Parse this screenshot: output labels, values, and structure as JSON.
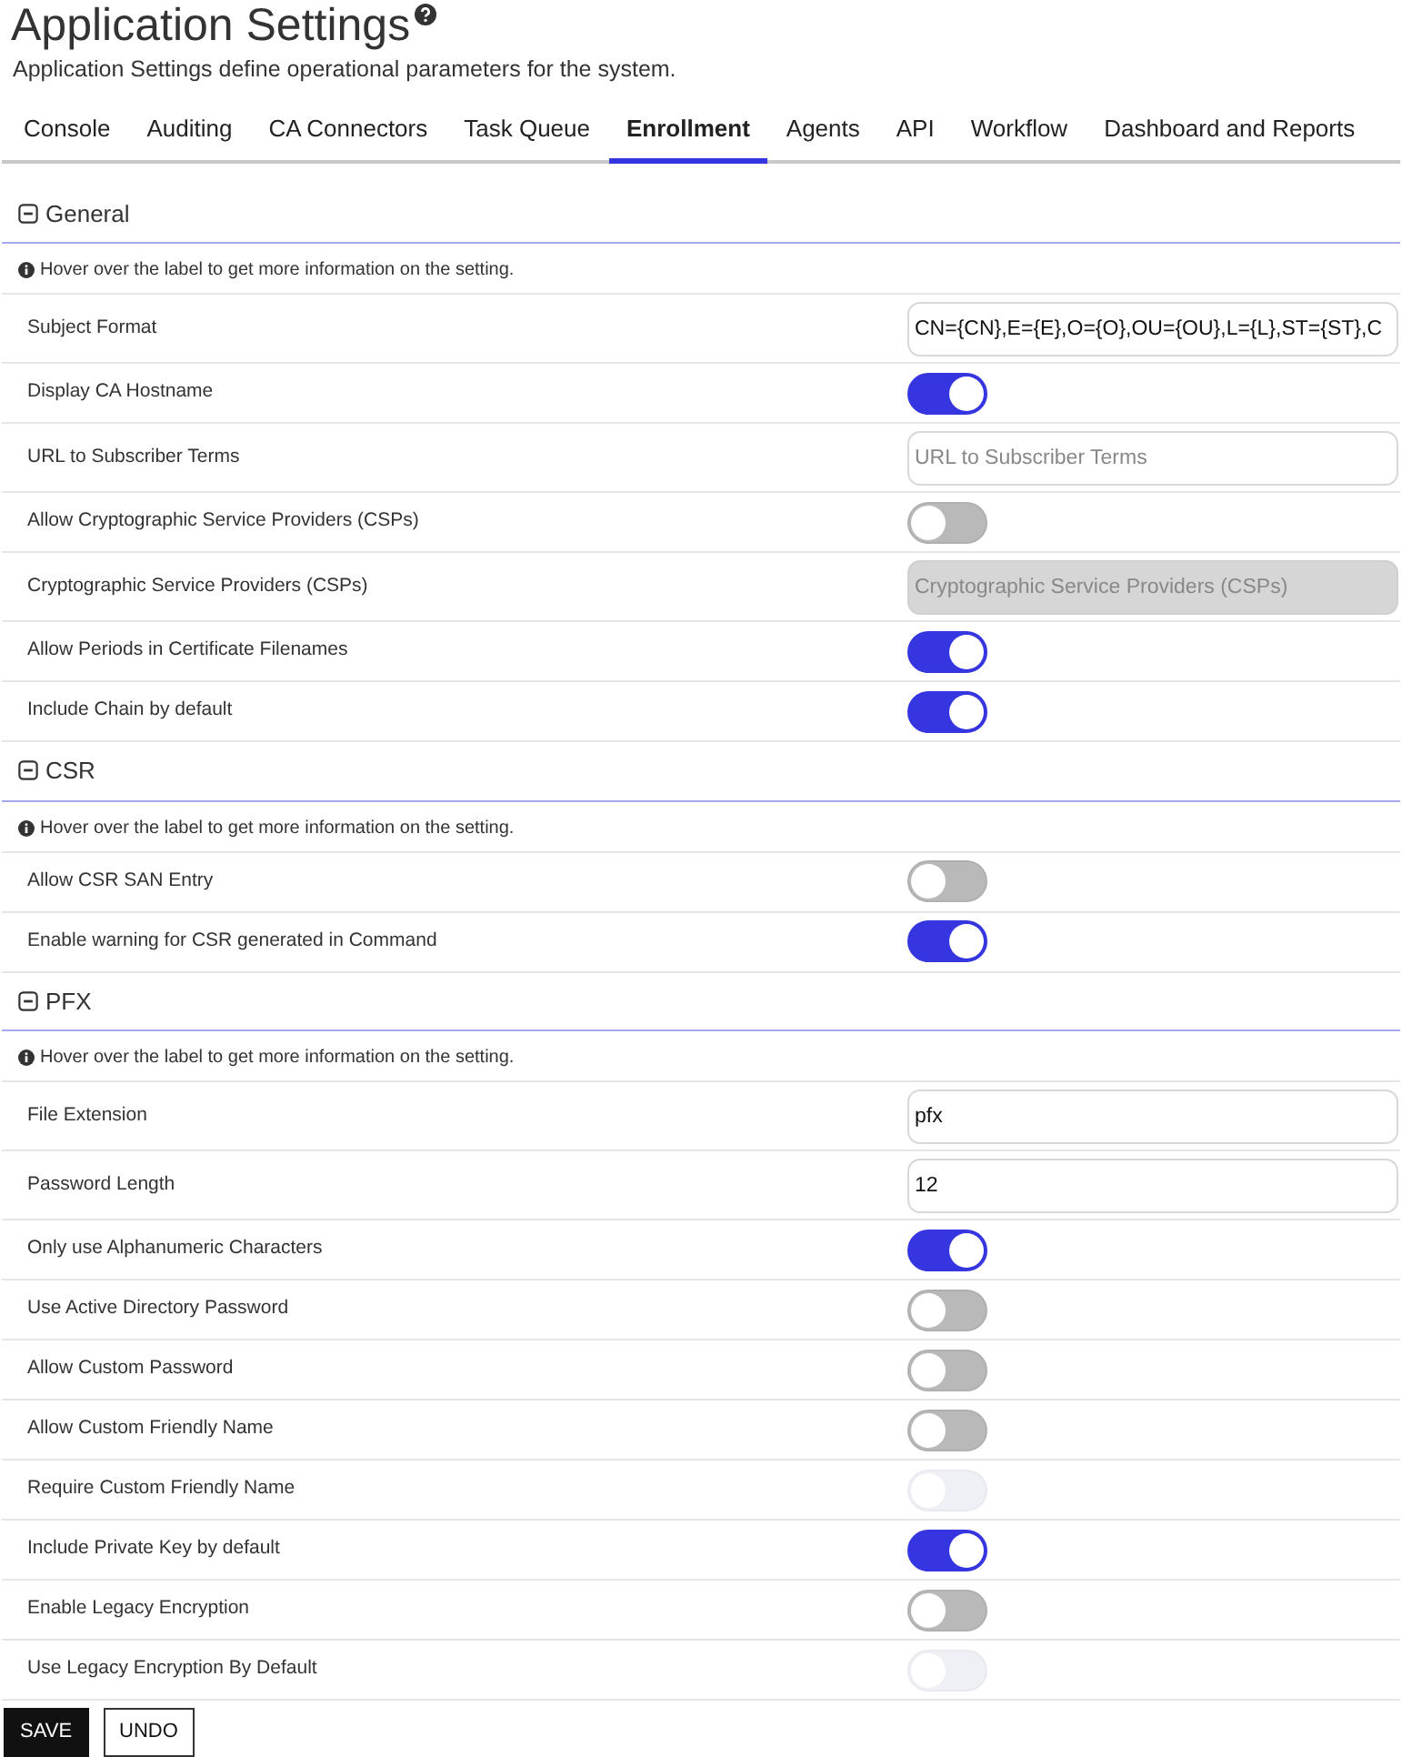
{
  "page": {
    "title": "Application Settings",
    "description": "Application Settings define operational parameters for the system."
  },
  "tabs": [
    {
      "label": "Console",
      "selected": false
    },
    {
      "label": "Auditing",
      "selected": false
    },
    {
      "label": "CA Connectors",
      "selected": false
    },
    {
      "label": "Task Queue",
      "selected": false
    },
    {
      "label": "Enrollment",
      "selected": true
    },
    {
      "label": "Agents",
      "selected": false
    },
    {
      "label": "API",
      "selected": false
    },
    {
      "label": "Workflow",
      "selected": false
    },
    {
      "label": "Dashboard and Reports",
      "selected": false
    }
  ],
  "sections": [
    {
      "title": "General",
      "expanded": true,
      "hint": "Hover over the label to get more information on the setting.",
      "settings": [
        {
          "label": "Subject Format",
          "kind": "text",
          "value": "CN={CN},E={E},O={O},OU={OU},L={L},ST={ST},C",
          "disabled": false
        },
        {
          "label": "Display CA Hostname",
          "kind": "toggle",
          "on": true,
          "disabled": false
        },
        {
          "label": "URL to Subscriber Terms",
          "kind": "text",
          "placeholder": "URL to Subscriber Terms",
          "disabled": false
        },
        {
          "label": "Allow Cryptographic Service Providers (CSPs)",
          "kind": "toggle",
          "on": false,
          "disabled": false
        },
        {
          "label": "Cryptographic Service Providers (CSPs)",
          "kind": "text",
          "placeholder": "Cryptographic Service Providers (CSPs)",
          "disabled": true
        },
        {
          "label": "Allow Periods in Certificate Filenames",
          "kind": "toggle",
          "on": true,
          "disabled": false
        },
        {
          "label": "Include Chain by default",
          "kind": "toggle",
          "on": true,
          "disabled": false
        }
      ]
    },
    {
      "title": "CSR",
      "expanded": true,
      "hint": "Hover over the label to get more information on the setting.",
      "settings": [
        {
          "label": "Allow CSR SAN Entry",
          "kind": "toggle",
          "on": false,
          "disabled": false
        },
        {
          "label": "Enable warning for CSR generated in Command",
          "kind": "toggle",
          "on": true,
          "disabled": false
        }
      ]
    },
    {
      "title": "PFX",
      "expanded": true,
      "hint": "Hover over the label to get more information on the setting.",
      "settings": [
        {
          "label": "File Extension",
          "kind": "text",
          "value": "pfx",
          "disabled": false
        },
        {
          "label": "Password Length",
          "kind": "text",
          "value": "12",
          "disabled": false
        },
        {
          "label": "Only use Alphanumeric Characters",
          "kind": "toggle",
          "on": true,
          "disabled": false
        },
        {
          "label": "Use Active Directory Password",
          "kind": "toggle",
          "on": false,
          "disabled": false
        },
        {
          "label": "Allow Custom Password",
          "kind": "toggle",
          "on": false,
          "disabled": false
        },
        {
          "label": "Allow Custom Friendly Name",
          "kind": "toggle",
          "on": false,
          "disabled": false
        },
        {
          "label": "Require Custom Friendly Name",
          "kind": "toggle",
          "on": false,
          "disabled": true
        },
        {
          "label": "Include Private Key by default",
          "kind": "toggle",
          "on": true,
          "disabled": false
        },
        {
          "label": "Enable Legacy Encryption",
          "kind": "toggle",
          "on": false,
          "disabled": false
        },
        {
          "label": "Use Legacy Encryption By Default",
          "kind": "toggle",
          "on": false,
          "disabled": true
        }
      ]
    }
  ],
  "buttons": [
    {
      "label": "SAVE",
      "kind": "primary"
    },
    {
      "label": "UNDO",
      "kind": "secondary"
    }
  ]
}
